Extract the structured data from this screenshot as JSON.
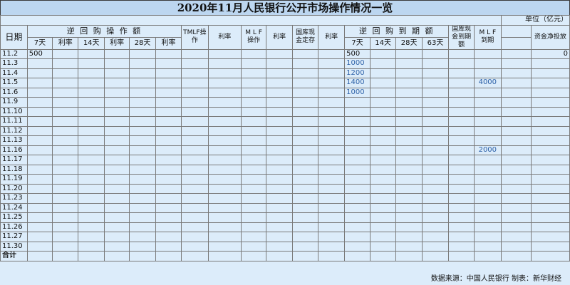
{
  "title": "2020年11月人民银行公开市场操作情况一览",
  "unit": "单位（亿元）",
  "headers": {
    "date": "日期",
    "reverse_repo_ops": "逆 回 购 操 作 额",
    "d7": "7天",
    "rate": "利率",
    "d14": "14天",
    "d28": "28天",
    "tmlf_ops": "TMLF操作",
    "mlf_ops": "M L F操作",
    "treasury_deposit": "国库现金定存",
    "reverse_repo_maturity": "逆 回 购 到 期 额",
    "d63": "63天",
    "treasury_maturity": "国库现金到期额",
    "mlf_maturity": "M L F到期",
    "net_injection": "资金净投放"
  },
  "rows": [
    {
      "date": "11.2",
      "op7": "500",
      "m7": "500",
      "net": "0"
    },
    {
      "date": "11.3",
      "m7": "1000"
    },
    {
      "date": "11.4",
      "m7": "1200"
    },
    {
      "date": "11.5",
      "m7": "1400",
      "mlf_mat": "4000"
    },
    {
      "date": "11.6",
      "m7": "1000"
    },
    {
      "date": "11.9"
    },
    {
      "date": "11.10"
    },
    {
      "date": "11.11"
    },
    {
      "date": "11.12"
    },
    {
      "date": "11.13"
    },
    {
      "date": "11.16",
      "mlf_mat": "2000"
    },
    {
      "date": "11.17"
    },
    {
      "date": "11.18"
    },
    {
      "date": "11.19"
    },
    {
      "date": "11.20"
    },
    {
      "date": "11.23"
    },
    {
      "date": "11.24"
    },
    {
      "date": "11.25"
    },
    {
      "date": "11.26"
    },
    {
      "date": "11.27"
    },
    {
      "date": "11.30"
    }
  ],
  "total_label": "合计",
  "footer": "数据来源：中国人民银行  制表：新华财经"
}
